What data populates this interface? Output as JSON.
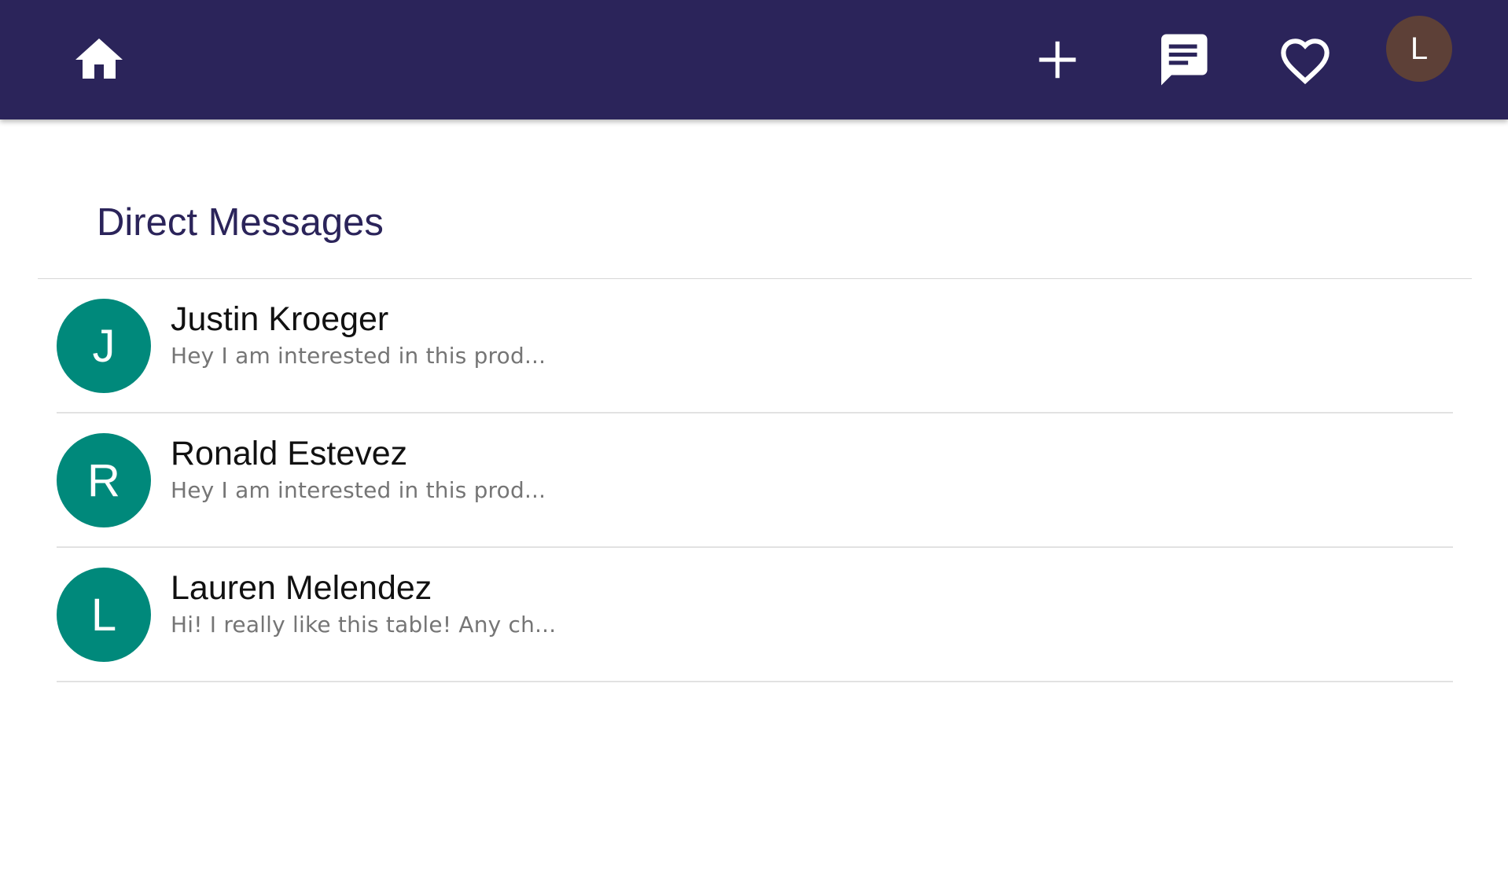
{
  "header": {
    "icons": {
      "home": "home-icon",
      "add": "plus-icon",
      "messages": "chat-bubble-icon",
      "favorites": "heart-outline-icon"
    },
    "user_avatar_initial": "L",
    "background_color": "#2b245a",
    "avatar_color": "#5d4037"
  },
  "page": {
    "title": "Direct Messages"
  },
  "conversations": [
    {
      "initial": "J",
      "name": "Justin Kroeger",
      "preview": "Hey I am interested in this prod..."
    },
    {
      "initial": "R",
      "name": "Ronald Estevez",
      "preview": "Hey I am interested in this prod..."
    },
    {
      "initial": "L",
      "name": "Lauren Melendez",
      "preview": "Hi! I really like this table! Any ch..."
    }
  ],
  "colors": {
    "accent": "#2b245a",
    "conversation_avatar": "#00897b"
  }
}
